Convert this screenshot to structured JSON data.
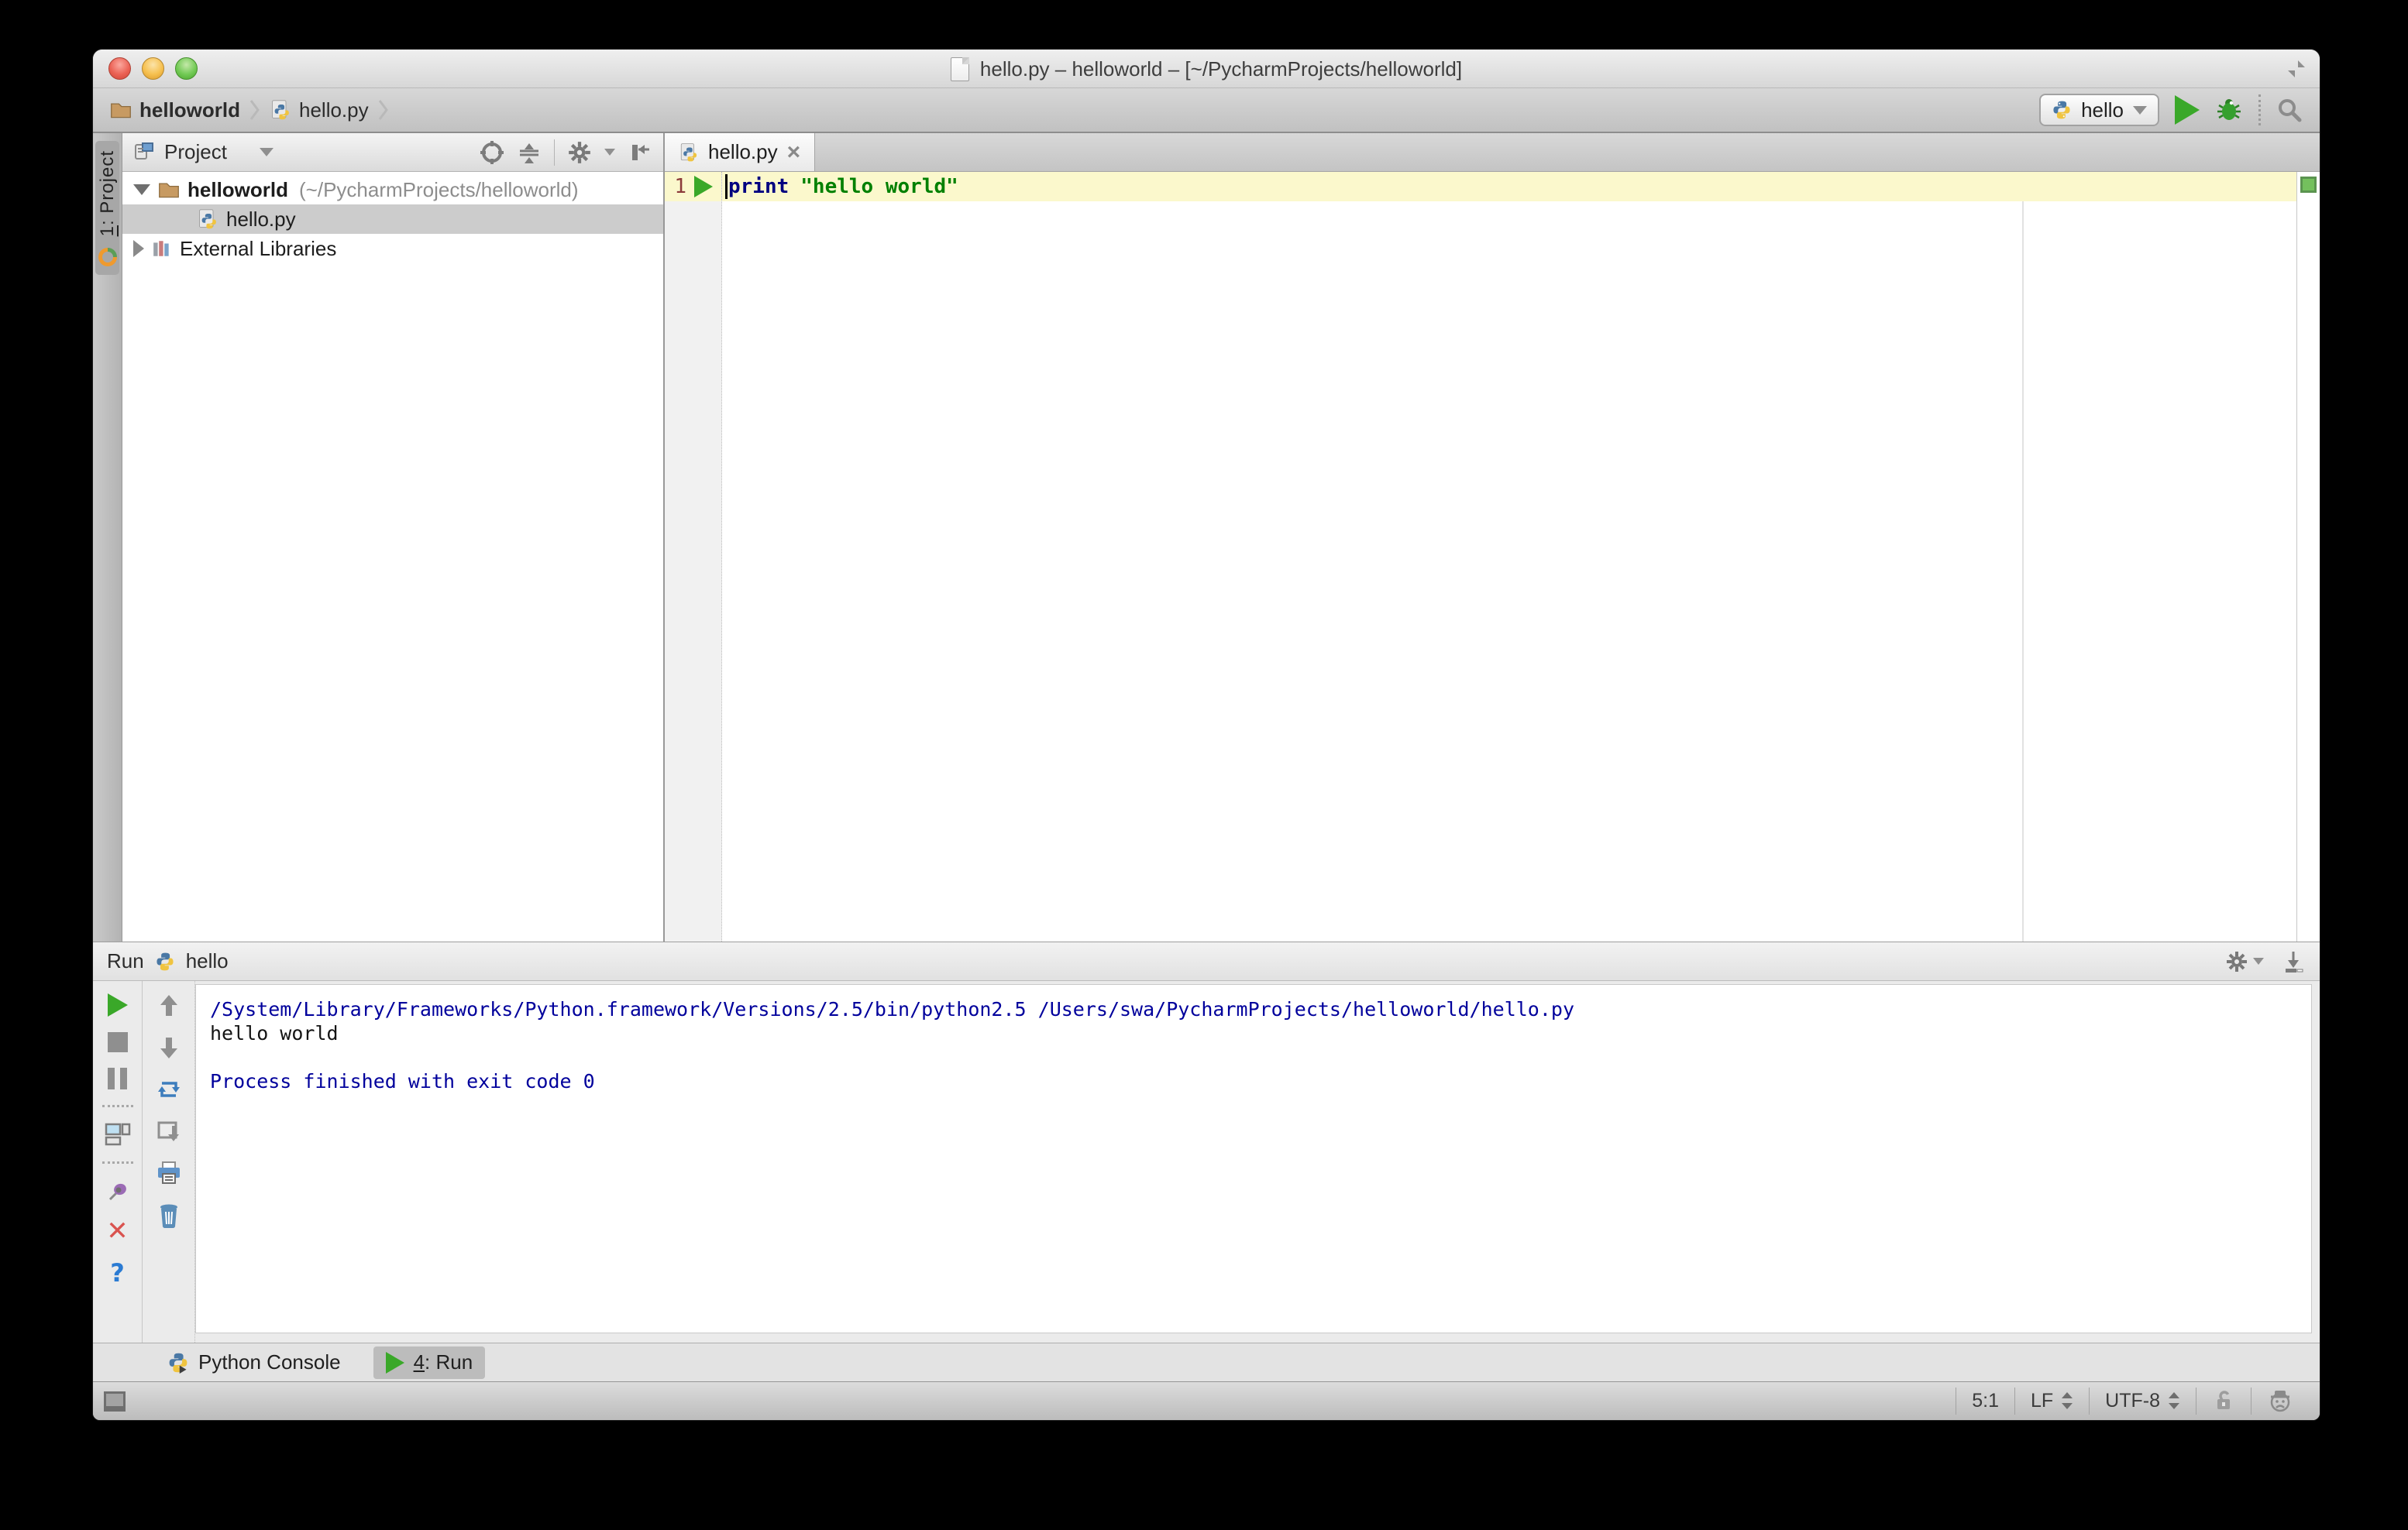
{
  "titlebar": {
    "title": "hello.py – helloworld – [~/PycharmProjects/helloworld]"
  },
  "navbar": {
    "breadcrumb_project": "helloworld",
    "breadcrumb_file": "hello.py",
    "run_config": "hello"
  },
  "stripe": {
    "mnemonic": "1",
    "label": ": Project"
  },
  "project": {
    "header": "Project",
    "root_name": "helloworld",
    "root_path": "(~/PycharmProjects/helloworld)",
    "file_name": "hello.py",
    "libs_label": "External Libraries"
  },
  "editor": {
    "tab_label": "hello.py",
    "close_glyph": "×",
    "line_number": "1",
    "keyword": "print",
    "string": "\"hello world\""
  },
  "run": {
    "title": "Run",
    "config": "hello",
    "console_lines": [
      "/System/Library/Frameworks/Python.framework/Versions/2.5/bin/python2.5 /Users/swa/PycharmProjects/helloworld/hello.py",
      "hello world",
      "",
      "Process finished with exit code 0"
    ]
  },
  "bottom_bar": {
    "python_console": "Python Console",
    "run_mnemonic": "4",
    "run_label": ": Run"
  },
  "status_bar": {
    "caret_position": "5:1",
    "line_separator": "LF",
    "encoding": "UTF-8"
  },
  "icons": {
    "close_x": "✕",
    "help": "?"
  },
  "colors": {
    "run_green": "#3aa829",
    "caret_line": "#fbf8cc",
    "keyword": "#000080",
    "string": "#008000",
    "console_system": "#00009c",
    "selection": "#cccccc"
  }
}
